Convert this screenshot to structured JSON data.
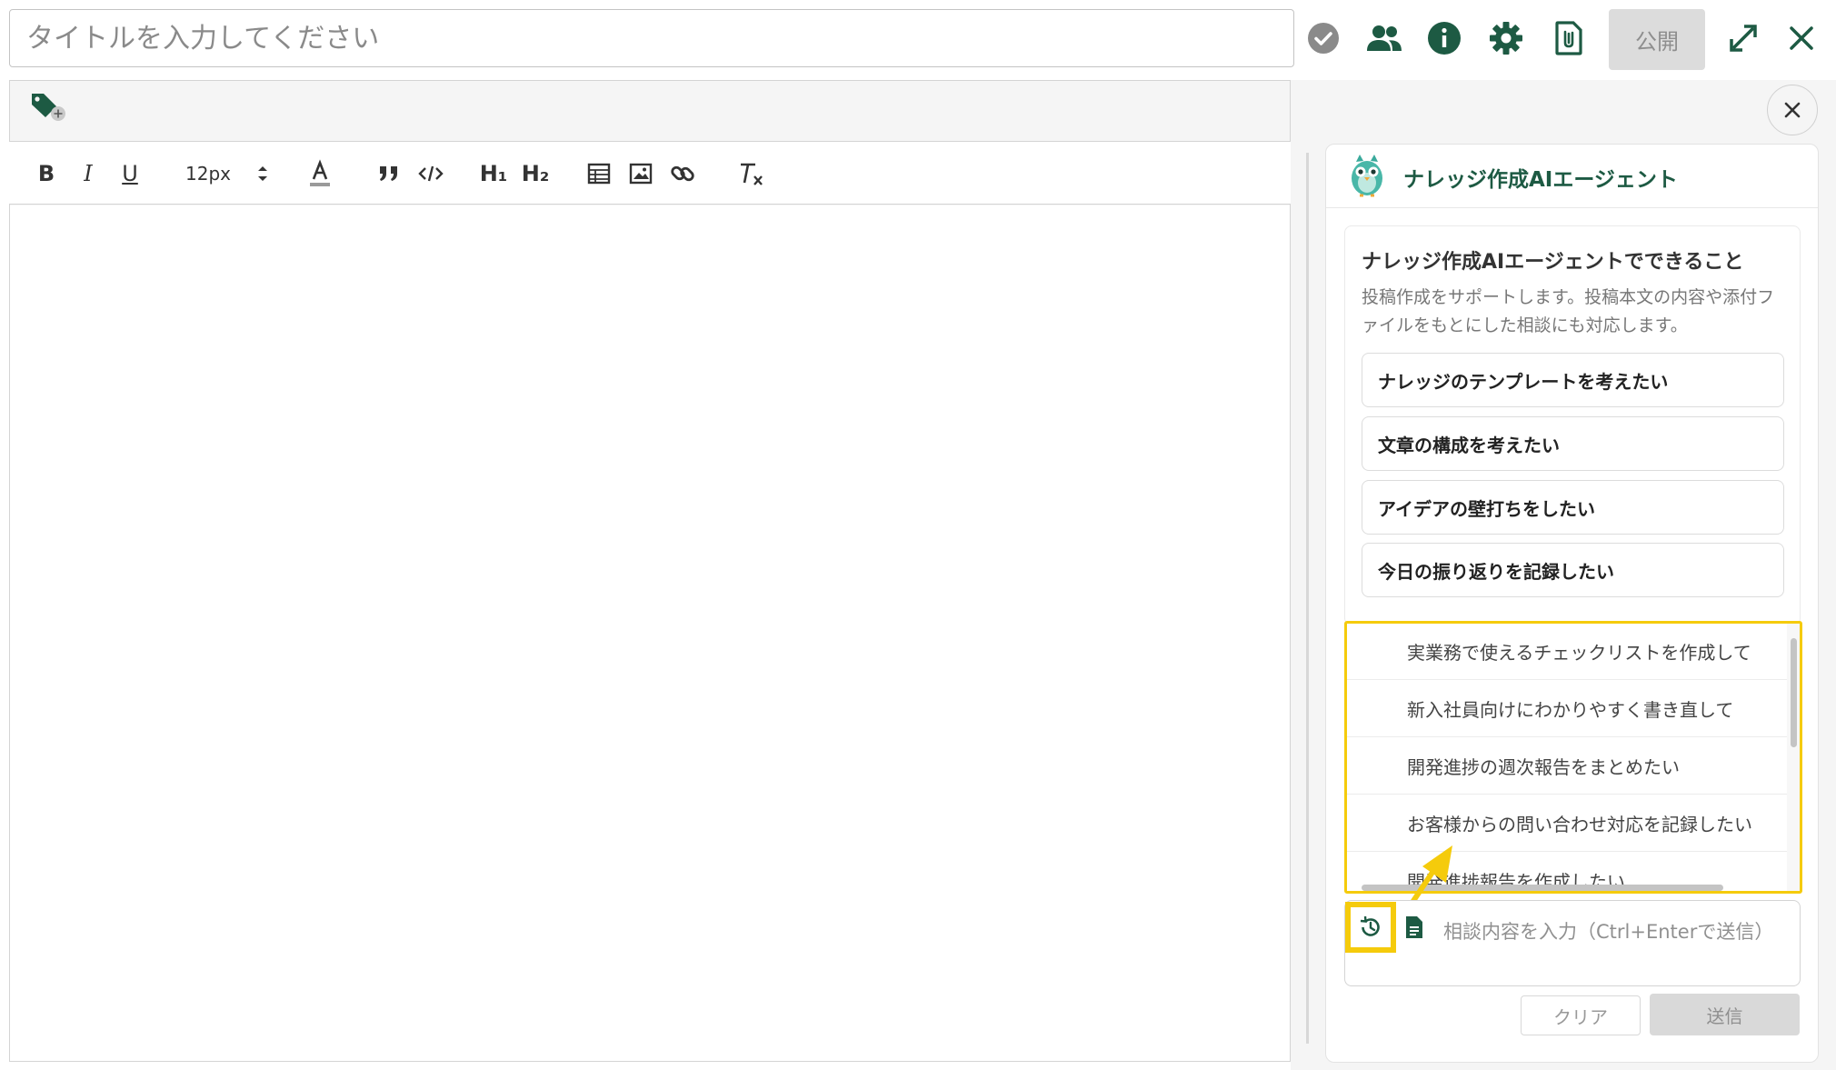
{
  "header": {
    "title_placeholder": "タイトルを入力してください",
    "publish_label": "公開"
  },
  "toolbar": {
    "bold": "B",
    "italic": "I",
    "underline": "U",
    "font_size": "12px",
    "heading1": "H₁",
    "heading2": "H₂"
  },
  "agent": {
    "title": "ナレッジ作成AIエージェント",
    "intro_title": "ナレッジ作成AIエージェントでできること",
    "intro_desc": "投稿作成をサポートします。投稿本文の内容や添付ファイルをもとにした相談にも対応します。",
    "suggestions": [
      "ナレッジのテンプレートを考えたい",
      "文章の構成を考えたい",
      "アイデアの壁打ちをしたい",
      "今日の振り返りを記録したい"
    ],
    "history": [
      "実業務で使えるチェックリストを作成して",
      "新入社員向けにわかりやすく書き直して",
      "開発進捗の週次報告をまとめたい",
      "お客様からの問い合わせ対応を記録したい",
      "開発進捗報告を作成したい"
    ],
    "input_placeholder": "相談内容を入力（Ctrl+Enterで送信）",
    "clear_label": "クリア",
    "send_label": "送信"
  },
  "colors": {
    "brand_green": "#1d5a43",
    "highlight_yellow": "#f5cb0c",
    "disabled_gray": "#d9d9d9"
  }
}
